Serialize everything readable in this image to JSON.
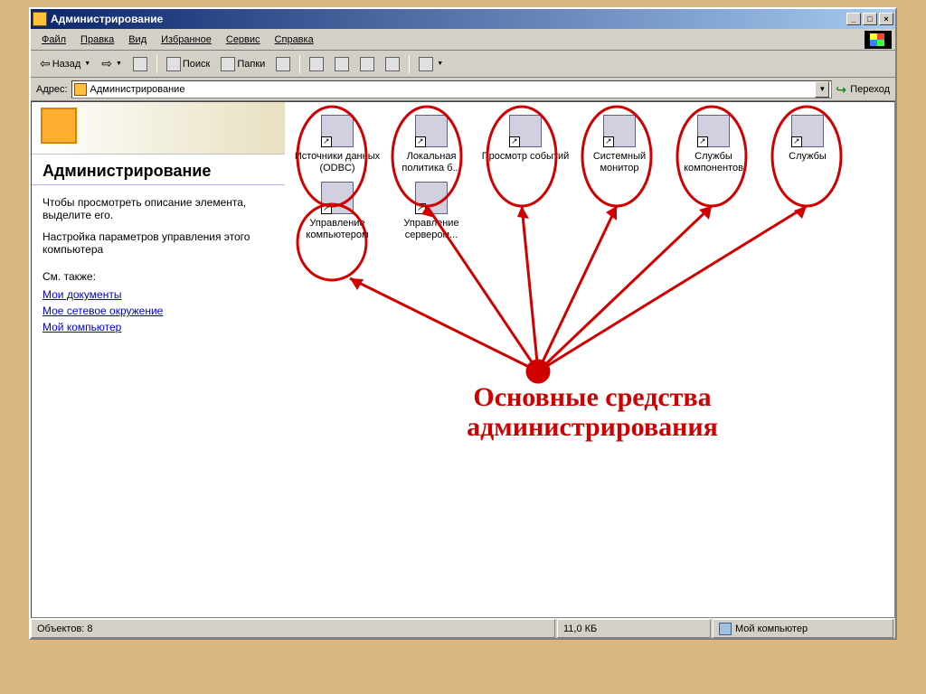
{
  "window": {
    "title": "Администрирование"
  },
  "menubar": {
    "items": [
      "Файл",
      "Правка",
      "Вид",
      "Избранное",
      "Сервис",
      "Справка"
    ]
  },
  "toolbar": {
    "back": "Назад",
    "search": "Поиск",
    "folders": "Папки"
  },
  "addressbar": {
    "label": "Адрес:",
    "value": "Администрирование",
    "go": "Переход"
  },
  "sidebar": {
    "title": "Администрирование",
    "desc": "Чтобы просмотреть описание элемента, выделите его.",
    "sub": "Настройка параметров управления этого компьютера",
    "see": "См. также:",
    "links": [
      "Мои документы",
      "Мое сетевое окружение",
      "Мой компьютер"
    ]
  },
  "icons": [
    {
      "label": "Источники данных (ODBC)"
    },
    {
      "label": "Локальная политика б..."
    },
    {
      "label": "Просмотр событий"
    },
    {
      "label": "Системный монитор"
    },
    {
      "label": "Службы компонентов"
    },
    {
      "label": "Службы"
    },
    {
      "label": "Управление компьютером"
    },
    {
      "label": "Управление сервером..."
    }
  ],
  "annotation": {
    "line1": "Основные средства",
    "line2": "администрирования"
  },
  "statusbar": {
    "objects": "Объектов: 8",
    "size": "11,0 КБ",
    "location": "Мой компьютер"
  }
}
